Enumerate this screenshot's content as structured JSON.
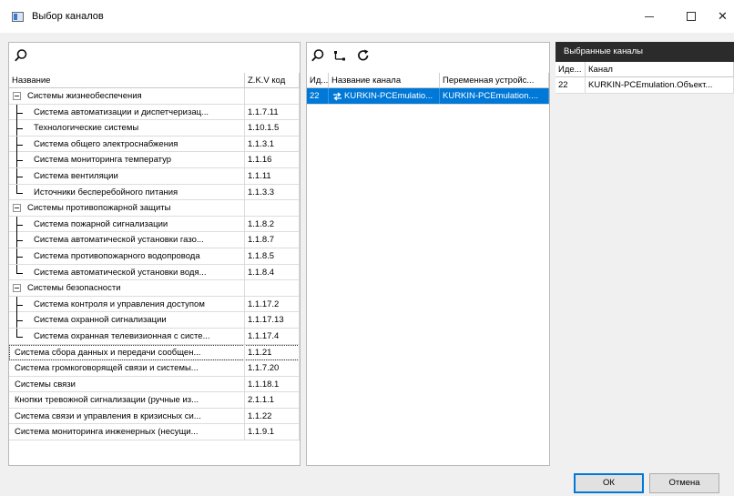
{
  "window": {
    "title": "Выбор каналов",
    "close_glyph": "✕"
  },
  "left": {
    "headers": {
      "name": "Название",
      "code": "Z.K.V код"
    },
    "rows": [
      {
        "name": "Системы жизнеобеспечения",
        "code": "",
        "level": 0,
        "expander": true
      },
      {
        "name": "Система автоматизации и диспетчеризац...",
        "code": "1.1.7.11",
        "level": 1
      },
      {
        "name": "Технологические системы",
        "code": "1.10.1.5",
        "level": 1
      },
      {
        "name": "Система общего электроснабжения",
        "code": "1.1.3.1",
        "level": 1
      },
      {
        "name": "Система мониторинга температур",
        "code": "1.1.16",
        "level": 1
      },
      {
        "name": "Система вентиляции",
        "code": "1.1.11",
        "level": 1
      },
      {
        "name": "Источники бесперебойного питания",
        "code": "1.1.3.3",
        "level": 1,
        "last": true
      },
      {
        "name": "Системы противопожарной защиты",
        "code": "",
        "level": 0,
        "expander": true
      },
      {
        "name": "Система пожарной сигнализации",
        "code": "1.1.8.2",
        "level": 1
      },
      {
        "name": "Система автоматической установки газо...",
        "code": "1.1.8.7",
        "level": 1
      },
      {
        "name": "Система противопожарного водопровода",
        "code": "1.1.8.5",
        "level": 1
      },
      {
        "name": "Система автоматической установки водя...",
        "code": "1.1.8.4",
        "level": 1,
        "last": true
      },
      {
        "name": "Системы безопасности",
        "code": "",
        "level": 0,
        "expander": true
      },
      {
        "name": "Система контроля и управления доступом",
        "code": "1.1.17.2",
        "level": 1
      },
      {
        "name": "Система охранной сигнализации",
        "code": "1.1.17.13",
        "level": 1
      },
      {
        "name": "Система охранная телевизионная с систе...",
        "code": "1.1.17.4",
        "level": 1,
        "last": true
      },
      {
        "name": "Система сбора данных и передачи сообщен...",
        "code": "1.1.21",
        "level": 0,
        "focused": true
      },
      {
        "name": "Система громкоговорящей связи и системы...",
        "code": "1.1.7.20",
        "level": 0
      },
      {
        "name": "Системы связи",
        "code": "1.1.18.1",
        "level": 0
      },
      {
        "name": "Кнопки тревожной сигнализации (ручные из...",
        "code": "2.1.1.1",
        "level": 0
      },
      {
        "name": "Система связи и управления в кризисных си...",
        "code": "1.1.22",
        "level": 0
      },
      {
        "name": "Система мониторинга инженерных (несущи...",
        "code": "1.1.9.1",
        "level": 0
      }
    ]
  },
  "middle": {
    "headers": {
      "id": "Ид...",
      "channel": "Название канала",
      "var": "Переменная устройс..."
    },
    "rows": [
      {
        "id": "22",
        "channel": "KURKIN-PCEmulatio...",
        "var": "KURKIN-PCEmulation...."
      }
    ]
  },
  "right": {
    "title": "Выбранные каналы",
    "headers": {
      "id": "Иде...",
      "channel": "Канал"
    },
    "rows": [
      {
        "id": "22",
        "channel": "KURKIN-PCEmulation.Объект..."
      }
    ]
  },
  "buttons": {
    "ok": "ОК",
    "cancel": "Отмена"
  },
  "icons": {
    "search": "search-icon",
    "tree": "tree-icon",
    "refresh": "refresh-icon",
    "channel": "channel-icon"
  }
}
